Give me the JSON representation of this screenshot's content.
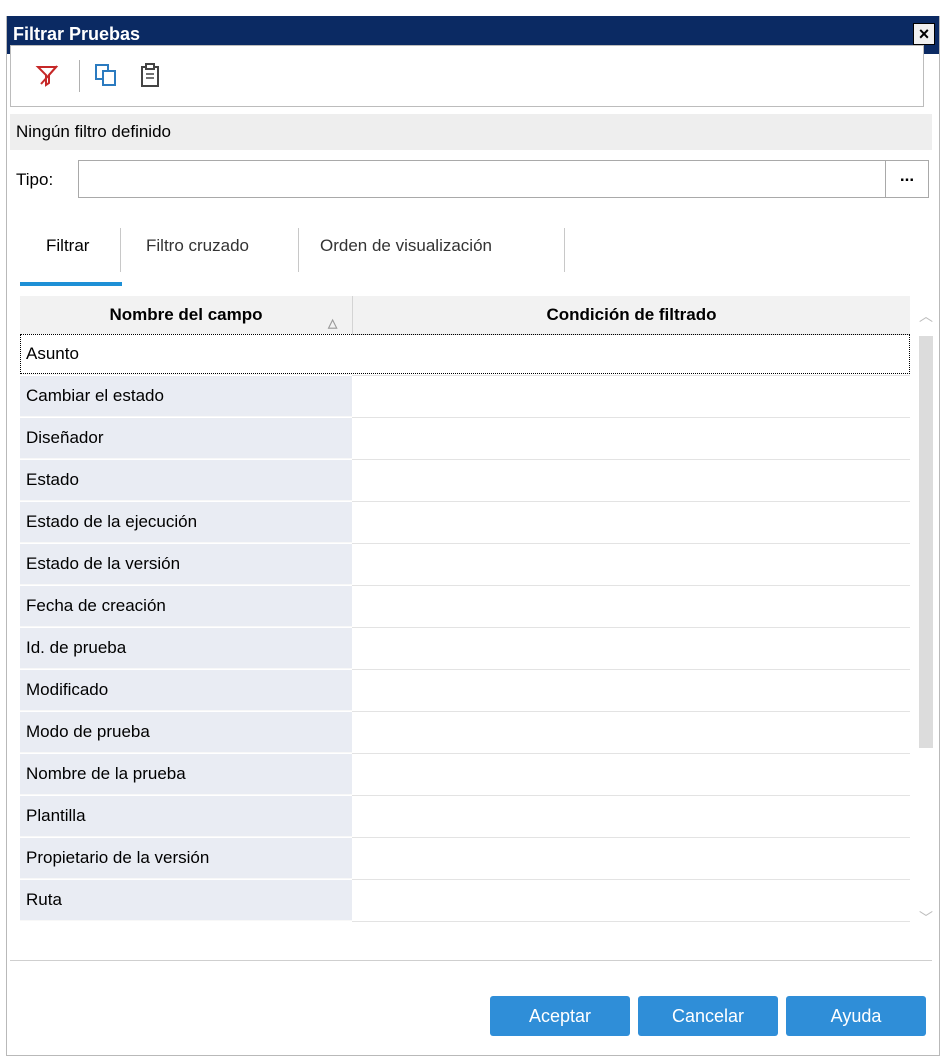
{
  "window": {
    "title": "Filtrar Pruebas",
    "close_glyph": "✕"
  },
  "toolbar": {
    "icons": [
      "clear-filter-icon",
      "copy-icon",
      "paste-icon"
    ]
  },
  "status_text": "Ningún filtro definido",
  "tipo": {
    "label": "Tipo:",
    "value": "",
    "browse_label": "..."
  },
  "tabs": [
    {
      "label": "Filtrar",
      "active": true
    },
    {
      "label": "Filtro cruzado",
      "active": false
    },
    {
      "label": "Orden de visualización",
      "active": false
    }
  ],
  "grid": {
    "col1": "Nombre del campo",
    "col2": "Condición de filtrado",
    "rows": [
      "Asunto",
      "Cambiar el estado",
      "Diseñador",
      "Estado",
      "Estado de la ejecución",
      "Estado de la versión",
      "Fecha de creación",
      "Id. de prueba",
      "Modificado",
      "Modo de prueba",
      "Nombre de la prueba",
      "Plantilla",
      "Propietario de la versión",
      "Ruta"
    ]
  },
  "buttons": {
    "ok": "Aceptar",
    "cancel": "Cancelar",
    "help": "Ayuda"
  },
  "colors": {
    "titlebar": "#0b2a63",
    "accent": "#1e90d6",
    "button": "#2f8ed8"
  }
}
